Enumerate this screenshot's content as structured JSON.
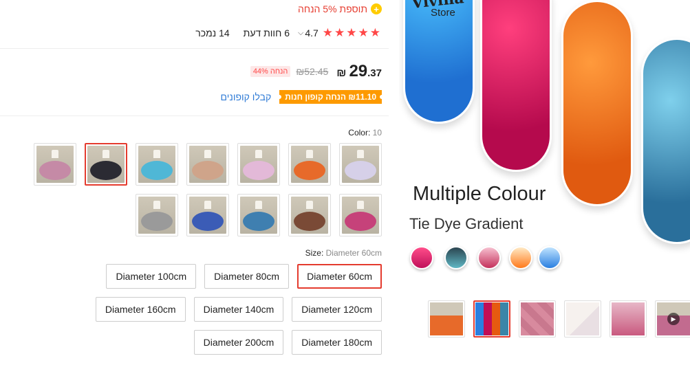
{
  "promo": {
    "icon": "plus-circle-icon",
    "text": "תוספת 5% הנחה"
  },
  "rating": {
    "score": "4.7",
    "reviews": "6 חוות דעת",
    "sold": "14 נמכר"
  },
  "price": {
    "integer": "29",
    "decimal": ".37",
    "currency": "₪",
    "original": "₪52.45",
    "discount": "הנחה 44%"
  },
  "coupon": {
    "tag": "₪11.10 הנחה קופון חנות",
    "link": "קבלו קופונים"
  },
  "color": {
    "label": "Color: ",
    "value": "10",
    "swatches": [
      {
        "color": "#d6d0e8"
      },
      {
        "color": "#e76a2a"
      },
      {
        "color": "#e3b9d8"
      },
      {
        "color": "#cfa48a"
      },
      {
        "color": "#4fb7d6"
      },
      {
        "color": "#2b2b33"
      },
      {
        "color": "#c58aa6"
      },
      {
        "color": "#c6427a"
      },
      {
        "color": "#7a4a36"
      },
      {
        "color": "#3f7fb0"
      },
      {
        "color": "#3b5cb6"
      },
      {
        "color": "#9a9a9a"
      }
    ],
    "selected_index": 5
  },
  "size": {
    "label": "Size: ",
    "value": "Diameter 60cm",
    "options": [
      "Diameter 60cm",
      "Diameter 80cm",
      "Diameter 100cm",
      "Diameter 120cm",
      "Diameter 140cm",
      "Diameter 160cm",
      "Diameter 180cm",
      "Diameter 200cm"
    ],
    "selected_index": 0
  },
  "hero": {
    "brand": "Vivina",
    "brand_sub": "Store",
    "title": "Multiple Colour",
    "subtitle": "Tie Dye Gradient"
  },
  "gallery": {
    "selected_index": 1,
    "video_icon": "play-icon"
  }
}
